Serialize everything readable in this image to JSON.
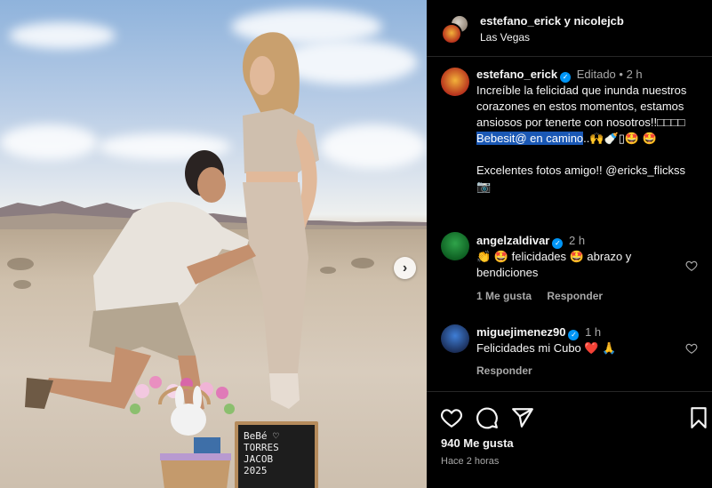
{
  "header": {
    "users": "estefano_erick y nicolejcb",
    "location": "Las Vegas"
  },
  "caption": {
    "username": "estefano_erick",
    "edited": "Editado",
    "dot": "•",
    "time": "2 h",
    "line1": "Increíble la felicidad que inunda nuestros corazones en estos momentos, estamos ansiosos por tenerte con nosotros!!□□□□",
    "highlight": "Bebesit@ en camino",
    "line2_rest": "..🙌🍼▯🤩 🤩",
    "line3": "Excelentes fotos amigo!! @ericks_flickss",
    "line3_emoji": "📷"
  },
  "comments": [
    {
      "username": "angelzaldivar",
      "time": "2 h",
      "text": "👏 🤩 felicidades 🤩 abrazo y bendiciones",
      "likes_label": "1 Me gusta",
      "reply_label": "Responder"
    },
    {
      "username": "miguejimenez90",
      "time": "1 h",
      "text": "Felicidades mi Cubo ❤️ 🙏",
      "reply_label": "Responder"
    }
  ],
  "chalkboard": {
    "line1": "BeBé ♡",
    "line2": "TORRES",
    "line3": "JACOB",
    "line4": "2025"
  },
  "footer": {
    "likes": "940 Me gusta",
    "time": "Hace 2 horas"
  },
  "colors": {
    "background": "#000000",
    "verified": "#0095f6",
    "highlight": "#1a58b5",
    "muted_text": "#a8a8a8",
    "like_heart": "#ed4956"
  },
  "icons": [
    "chevron-right-icon",
    "verified-icon",
    "heart-icon",
    "comment-icon",
    "share-icon",
    "bookmark-icon"
  ]
}
